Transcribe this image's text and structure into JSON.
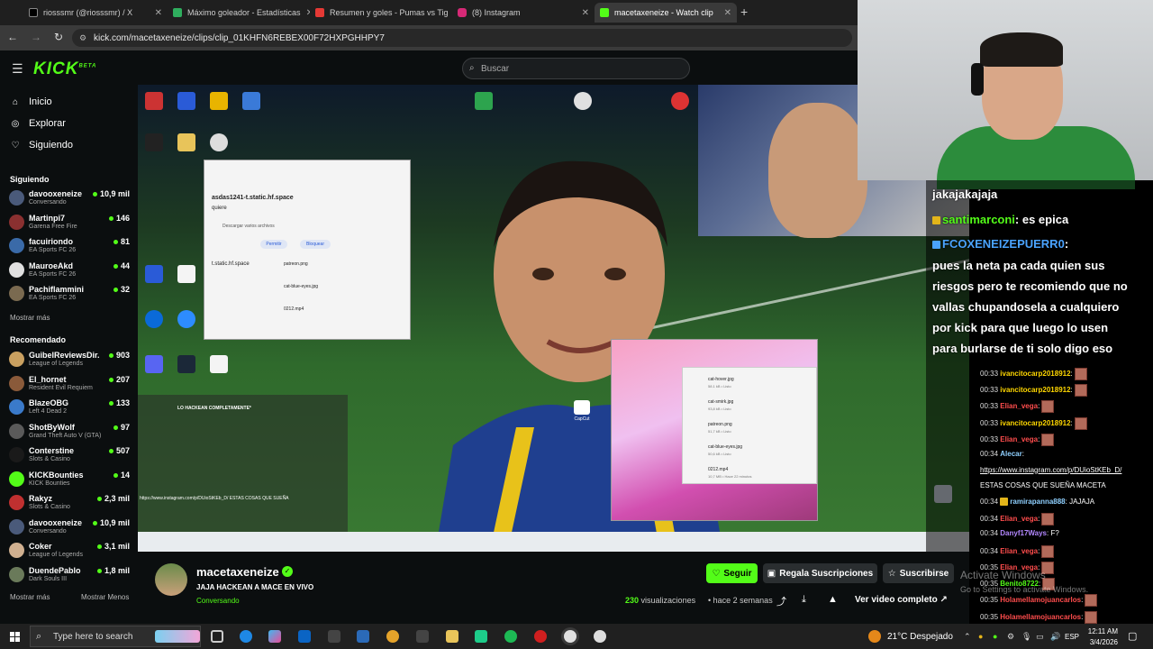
{
  "browser": {
    "tabs": [
      {
        "label": "riosssmr (@riosssmr) / X",
        "color": "#000000",
        "active": false
      },
      {
        "label": "Máximo goleador - Estadísticas",
        "color": "#2fae5e",
        "active": false
      },
      {
        "label": "Resumen y goles - Pumas vs Tig",
        "color": "#e53935",
        "active": false
      },
      {
        "label": "(8) Instagram",
        "color": "#d62976",
        "active": false
      },
      {
        "label": "macetaxeneize - Watch clip",
        "color": "#53fc18",
        "active": true
      }
    ],
    "tab_counts": "(2)",
    "new_tab": "+",
    "url": "kick.com/macetaxeneize/clips/clip_01KHFN6REBEX00F72HXPGHHPY7"
  },
  "kick": {
    "logo": "KICK",
    "logo_sup": "BETA",
    "search_placeholder": "Buscar",
    "nav": [
      {
        "label": "Inicio",
        "icon": "home-icon"
      },
      {
        "label": "Explorar",
        "icon": "compass-icon"
      },
      {
        "label": "Siguiendo",
        "icon": "heart-icon"
      }
    ],
    "following_title": "Siguiendo",
    "following": [
      {
        "name": "davooxeneize",
        "category": "Conversando",
        "viewers": "10,9 mil",
        "color": "#4a5a7a"
      },
      {
        "name": "Martinpi7",
        "category": "Garena Free Fire",
        "viewers": "146",
        "color": "#8a3030"
      },
      {
        "name": "facuiriondo",
        "category": "EA Sports FC 26",
        "viewers": "81",
        "color": "#3a6aa8"
      },
      {
        "name": "MauroeAkd",
        "category": "EA Sports FC 26",
        "viewers": "44",
        "color": "#e0e0e0"
      },
      {
        "name": "Pachiflammini",
        "category": "EA Sports FC 26",
        "viewers": "32",
        "color": "#7a6a50"
      }
    ],
    "show_more": "Mostrar más",
    "recommended_title": "Recomendado",
    "recommended": [
      {
        "name": "GuibelReviewsDir...",
        "category": "League of Legends",
        "viewers": "903",
        "color": "#c9a060"
      },
      {
        "name": "El_hornet",
        "category": "Resident Evil Requiem",
        "viewers": "207",
        "color": "#8a5a3a"
      },
      {
        "name": "BlazeOBG",
        "category": "Left 4 Dead 2",
        "viewers": "133",
        "color": "#3a7aca"
      },
      {
        "name": "ShotByWolf",
        "category": "Grand Theft Auto V (GTA)",
        "viewers": "97",
        "color": "#5a5a5a"
      },
      {
        "name": "Conterstine",
        "category": "Slots & Casino",
        "viewers": "507",
        "color": "#1a1a1a"
      },
      {
        "name": "KICKBounties",
        "category": "KICK Bounties",
        "viewers": "14",
        "color": "#53fc18"
      },
      {
        "name": "Rakyz",
        "category": "Slots & Casino",
        "viewers": "2,3 mil",
        "color": "#c03030"
      },
      {
        "name": "davooxeneize",
        "category": "Conversando",
        "viewers": "10,9 mil",
        "color": "#4a5a7a"
      },
      {
        "name": "Coker",
        "category": "League of Legends",
        "viewers": "3,1 mil",
        "color": "#d0b090"
      },
      {
        "name": "DuendePablo",
        "category": "Dark Souls III",
        "viewers": "1,8 mil",
        "color": "#6a7a5a"
      }
    ],
    "show_less": "Mostrar Menos"
  },
  "video": {
    "popup1_title": "asdas1241-t.static.hf.space",
    "popup1_sub": "quiere",
    "popup1_item": "Descargar varios archivos",
    "popup1_allow": "Permitir",
    "popup1_block": "Bloquear",
    "popup1_host": "t.static.hf.space",
    "files": [
      {
        "name": "cat-hover.jpg",
        "meta": "58.1 kB • Listo"
      },
      {
        "name": "cat-smirk.jpg",
        "meta": "93,8 kB • Listo"
      },
      {
        "name": "patreon.png",
        "meta": "51,7 kB • Listo"
      },
      {
        "name": "cat-blue-eyes.jpg",
        "meta": "50,6 kB • Listo"
      },
      {
        "name": "0212.mp4",
        "meta": "10,7 MB • Hace 22 minutos"
      }
    ],
    "capcut": "CapCut",
    "stream_overlay_text": "LO HACKEAN COMPLETAMENTE*",
    "overlay_link": "https://www.instagram.com/p/DUioStKEb_D/ ESTAS COSAS QUE SUEÑA"
  },
  "chat_large": [
    {
      "text": "jakajakajaja"
    },
    {
      "user": "santimarconi",
      "text": ": es epica",
      "color": "#53fc18"
    },
    {
      "user": "FCOXENEIZEPUERR0",
      "text": ":",
      "color": "#4aa3ff"
    },
    {
      "text": "pues la neta pa cada quien sus"
    },
    {
      "text": "riesgos pero te recomiendo que no"
    },
    {
      "text": "vallas chupandosela a cualquiero"
    },
    {
      "text": "por kick para que luego lo usen"
    },
    {
      "text": "para burlarse de ti solo digo eso"
    }
  ],
  "chat_small": [
    {
      "time": "00:33",
      "user": "ivancitocarp2018912",
      "color": "#ffd700",
      "text": ":",
      "emote": true
    },
    {
      "time": "00:33",
      "user": "ivancitocarp2018912",
      "color": "#ffd700",
      "text": ":",
      "emote": true
    },
    {
      "time": "00:33",
      "user": "Elian_vega",
      "color": "#ff4d4d",
      "text": ":",
      "emote": true
    },
    {
      "time": "00:33",
      "user": "ivancitocarp2018912",
      "color": "#ffd700",
      "text": ":",
      "emote": true
    },
    {
      "time": "00:33",
      "user": "Elian_vega",
      "color": "#ff4d4d",
      "text": ":",
      "emote": true
    },
    {
      "time": "00:34",
      "user": "Alecar",
      "color": "#8fd0ff",
      "text": ":",
      "emote": false
    },
    {
      "time": "",
      "user": "",
      "color": "#ffffff",
      "text": "https://www.instagram.com/p/DUioStKEb_D/",
      "emote": false,
      "link": true
    },
    {
      "time": "",
      "user": "",
      "color": "#ffffff",
      "text": "ESTAS COSAS QUE SUEÑA MACETA",
      "emote": false
    },
    {
      "time": "00:34",
      "user": "ramirapanna888",
      "color": "#8fd0ff",
      "text": ": JAJAJA",
      "emote": false,
      "badge": true
    },
    {
      "time": "00:34",
      "user": "Elian_vega",
      "color": "#ff4d4d",
      "text": ":",
      "emote": true
    },
    {
      "time": "00:34",
      "user": "Danyf17Ways",
      "color": "#b388ff",
      "text": ": F?",
      "emote": false
    },
    {
      "time": "00:34",
      "user": "Elian_vega",
      "color": "#ff4d4d",
      "text": ":",
      "emote": true
    },
    {
      "time": "00:35",
      "user": "Elian_vega",
      "color": "#ff4d4d",
      "text": ":",
      "emote": true
    },
    {
      "time": "00:35",
      "user": "Benito8722",
      "color": "#53fc18",
      "text": ":",
      "emote": true
    },
    {
      "time": "00:35",
      "user": "Holamellamojuancarlos",
      "color": "#ff4d4d",
      "text": ":",
      "emote": true
    },
    {
      "time": "00:35",
      "user": "Holamellamojuancarlos",
      "color": "#ff4d4d",
      "text": ":",
      "emote": true
    }
  ],
  "clip": {
    "channel": "macetaxeneize",
    "title": "JAJA HACKEAN A MACE EN VIVO",
    "category": "Conversando",
    "follow": "Seguir",
    "gift": "Regala Suscripciones",
    "subscribe": "Suscribirse",
    "views": "230",
    "views_label": "visualizaciones",
    "ago": "• hace 2 semanas",
    "watch_full": "Ver video completo"
  },
  "watermark": {
    "line1": "Activate Windows",
    "line2": "Go to Settings to activate Windows."
  },
  "taskbar": {
    "search": "Type here to search",
    "weather": "21°C  Despejado",
    "lang": "ESP",
    "time": "12:11 AM",
    "date": "3/4/2026"
  }
}
